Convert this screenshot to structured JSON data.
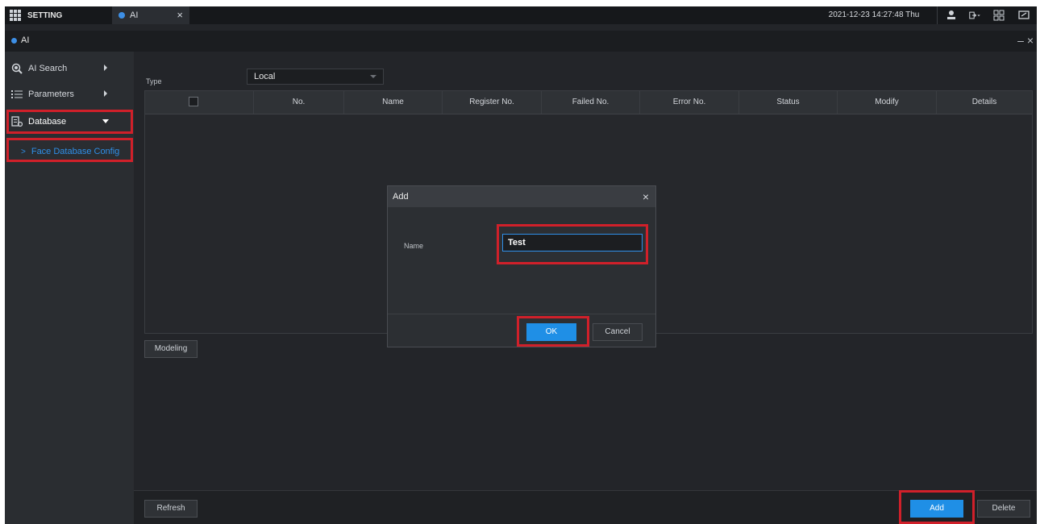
{
  "topbar": {
    "setting_label": "SETTING",
    "tab_label": "AI",
    "tab_close": "×",
    "datetime": "2021-12-23 14:27:48 Thu",
    "icons": [
      "user-icon",
      "logout-icon",
      "grid-icon",
      "fullscreen-icon"
    ]
  },
  "window": {
    "title": "AI",
    "controls": "– ×"
  },
  "sidebar": {
    "items": [
      {
        "label": "AI Search",
        "icon": "ai-search-icon"
      },
      {
        "label": "Parameters",
        "icon": "list-icon"
      },
      {
        "label": "Database",
        "icon": "database-icon"
      }
    ],
    "sub_item": {
      "label": "Face Database Config",
      "chevron": ">"
    }
  },
  "main": {
    "type_label": "Type",
    "type_value": "Local",
    "columns": [
      "No.",
      "Name",
      "Register No.",
      "Failed No.",
      "Error No.",
      "Status",
      "Modify",
      "Details"
    ],
    "modeling_label": "Modeling"
  },
  "footer": {
    "refresh_label": "Refresh",
    "add_label": "Add",
    "delete_label": "Delete"
  },
  "dialog": {
    "title": "Add",
    "close": "×",
    "name_label": "Name",
    "name_value": "Test",
    "ok_label": "OK",
    "cancel_label": "Cancel"
  },
  "colors": {
    "accent": "#1f8fe6",
    "highlight": "#d0202a",
    "background": "#232529"
  }
}
